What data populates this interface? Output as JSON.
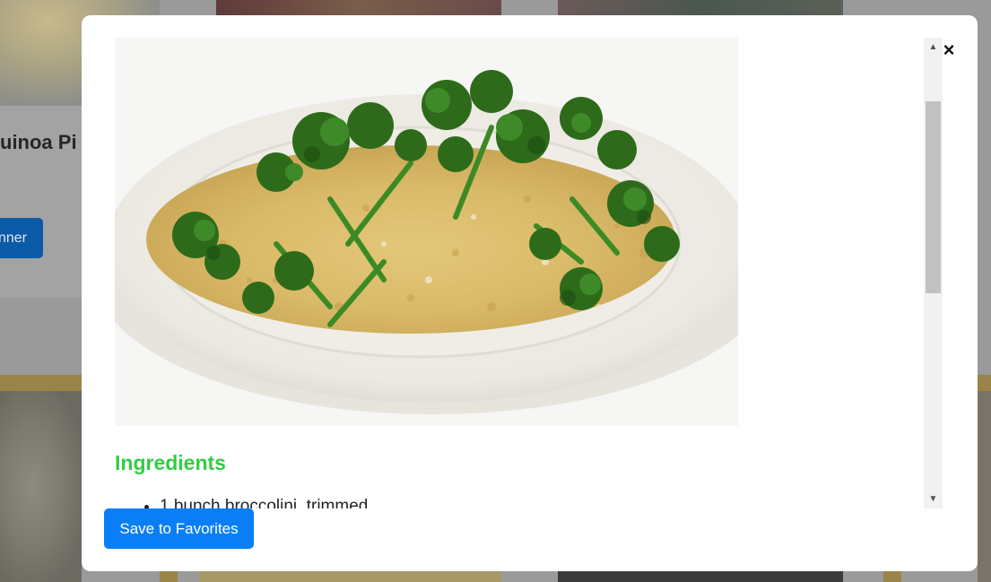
{
  "background": {
    "card_title": "uinoa Pi",
    "card_button_label": "nner"
  },
  "modal": {
    "close_label": "×",
    "image_alt": "Quinoa with broccolini on a white plate",
    "ingredients_heading": "Ingredients",
    "ingredients": [
      "1 bunch broccolini, trimmed"
    ],
    "scroll_up_glyph": "▲",
    "scroll_down_glyph": "▼",
    "save_button_label": "Save to Favorites"
  },
  "colors": {
    "accent_button": "#0a7ff5",
    "ingredients_heading": "#33cc44"
  }
}
